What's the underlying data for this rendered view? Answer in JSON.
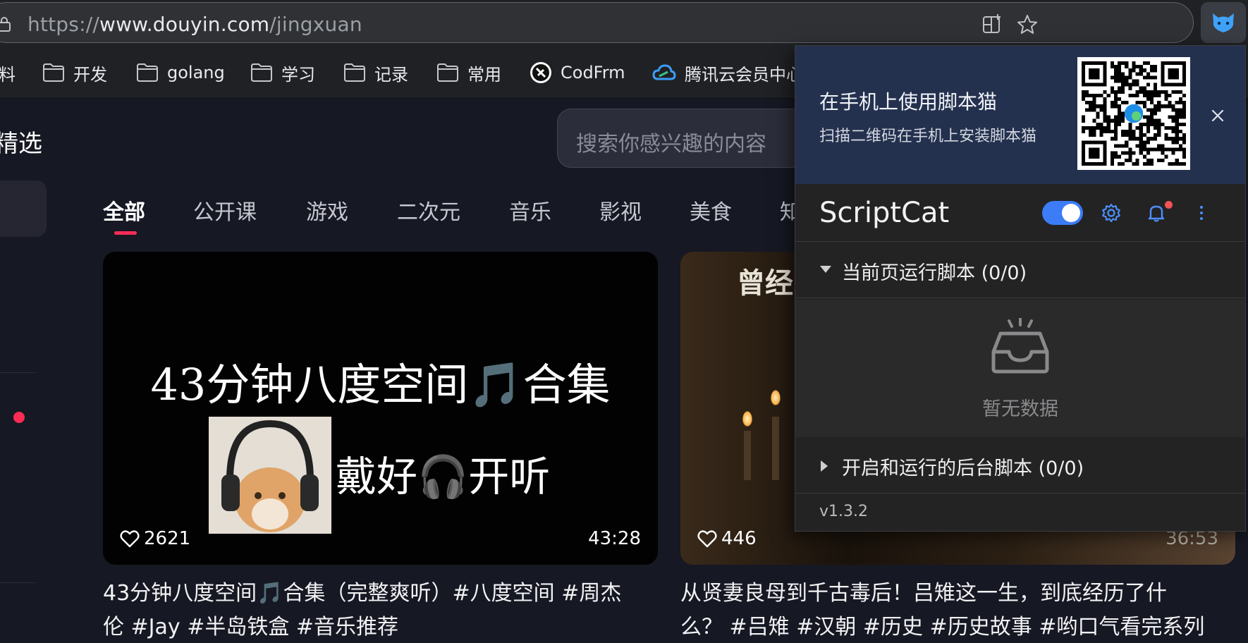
{
  "browser": {
    "url_scheme": "https://",
    "url_host": "www.douyin.com",
    "url_path": "/jingxuan",
    "extension_name": "ScriptCat"
  },
  "bookmarks": [
    {
      "label": "料",
      "icon": "none"
    },
    {
      "label": "开发",
      "icon": "folder-icon"
    },
    {
      "label": "golang",
      "icon": "folder-icon"
    },
    {
      "label": "学习",
      "icon": "folder-icon"
    },
    {
      "label": "记录",
      "icon": "folder-icon"
    },
    {
      "label": "常用",
      "icon": "folder-icon"
    },
    {
      "label": "CodFrm",
      "icon": "codfrm-logo-icon"
    },
    {
      "label": "腾讯云会员中心",
      "icon": "tencent-cloud-icon"
    }
  ],
  "page": {
    "title": "精选",
    "search_placeholder": "搜索你感兴趣的内容",
    "tabs": [
      {
        "label": "全部",
        "active": true
      },
      {
        "label": "公开课"
      },
      {
        "label": "游戏"
      },
      {
        "label": "二次元"
      },
      {
        "label": "音乐"
      },
      {
        "label": "影视"
      },
      {
        "label": "美食"
      },
      {
        "label": "知"
      }
    ],
    "videos": [
      {
        "cover_line1": "43分钟八度空间🎵合集",
        "cover_line2": "戴好🎧开听",
        "likes": "2621",
        "duration": "43:28",
        "caption_line1": "43分钟八度空间🎵合集（完整爽听）#八度空间 #周杰",
        "caption_line2": "伦 #Jay #半岛铁盒 #音乐推荐"
      },
      {
        "cover_stamp": "曾经",
        "likes": "446",
        "duration": "36:53",
        "caption_line1": "从贤妻良母到千古毒后！吕雉这一生，到底经历了什",
        "caption_line2": "么？ #吕雉 #汉朝 #历史 #历史故事 #哟口气看完系列"
      }
    ]
  },
  "popup": {
    "promo_title": "在手机上使用脚本猫",
    "promo_subtitle": "扫描二维码在手机上安装脚本猫",
    "app_title": "ScriptCat",
    "enabled": true,
    "section_current": "当前页运行脚本 (0/0)",
    "empty_text": "暂无数据",
    "section_background": "开启和运行的后台脚本 (0/0)",
    "version": "v1.3.2"
  },
  "colors": {
    "accent_red": "#fe2c55",
    "toggle_blue": "#3c7cf6",
    "promo_bg": "#24314e",
    "page_bg": "#161823"
  }
}
